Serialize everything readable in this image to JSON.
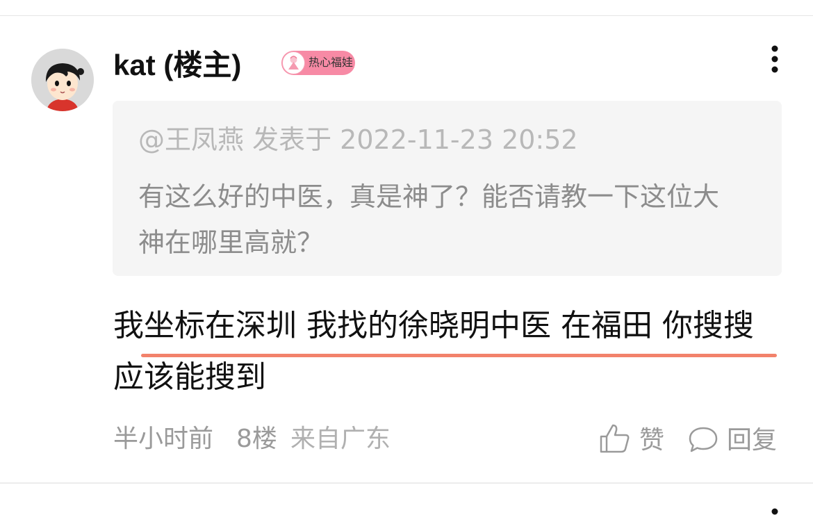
{
  "post": {
    "username": "kat (楼主)",
    "badge_label": "热心福娃",
    "quote": {
      "meta": "@王凤燕 发表于 2022-11-23 20:52",
      "text": "有这么好的中医，真是神了？能否请教一下这位大神在哪里高就？"
    },
    "reply_text": "我坐标在深圳 我找的徐晓明中医 在福田 你搜搜应该能搜到",
    "time": "半小时前",
    "floor": "8楼",
    "region": "来自广东",
    "like_label": "赞",
    "reply_label": "回复"
  },
  "icons": {
    "avatar": "cartoon-avatar",
    "badge": "doll-icon",
    "more": "more-vertical-icon",
    "like": "thumbs-up-icon",
    "reply": "comment-bubble-icon"
  },
  "colors": {
    "underline": "#f2826b",
    "badge_bg": "#f78aa5",
    "quote_bg": "#f5f5f5",
    "muted_text": "#9a9a9a"
  }
}
